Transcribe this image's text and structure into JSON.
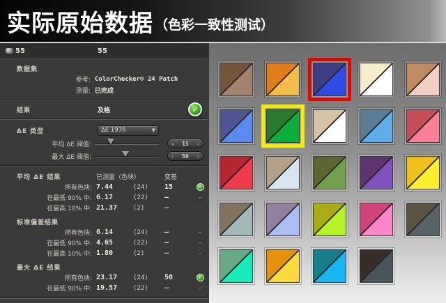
{
  "header": {
    "title": "实际原始数据",
    "subtitle": "（色彩一致性测试）"
  },
  "panel": {
    "top": {
      "left_label": "55",
      "center_label": "55"
    },
    "dataset": {
      "section_label": "数据集",
      "rows": [
        {
          "label": "参考:",
          "value": "ColorChecker® 24 Patch"
        },
        {
          "label": "测量:",
          "value": "已完成"
        }
      ]
    },
    "result": {
      "label": "结果",
      "value": "及格"
    },
    "de_type": {
      "label": "ΔE 类型",
      "dropdown_value": "ΔE 1976",
      "sliders": [
        {
          "label": "平均 ΔE 阈值:",
          "value": "15",
          "pos": 25
        },
        {
          "label": "最大 ΔE 阈值:",
          "value": "50",
          "pos": 48
        }
      ]
    },
    "results_table": {
      "col_measured": "已测量（色块）",
      "col_variance": "变差",
      "sections": [
        {
          "title": "平均 ΔE 结果",
          "rows": [
            {
              "label": "所有色块:",
              "value": "7.44",
              "count": "(24)",
              "variance": "15",
              "check": true
            },
            {
              "label": "在最低 90% 中:",
              "value": "6.17",
              "count": "(22)",
              "variance": "–",
              "check": false
            },
            {
              "label": "在最高 10% 中:",
              "value": "21.37",
              "count": "(2)",
              "variance": "–",
              "check": false
            }
          ]
        },
        {
          "title": "标准偏差结果",
          "rows": [
            {
              "label": "所有色块:",
              "value": "6.14",
              "count": "(24)",
              "variance": "–",
              "check": false
            },
            {
              "label": "在最低 90% 中:",
              "value": "4.65",
              "count": "(22)",
              "variance": "–",
              "check": false
            },
            {
              "label": "在最高 10% 中:",
              "value": "1.80",
              "count": "(2)",
              "variance": "–",
              "check": false
            }
          ]
        },
        {
          "title": "最大 ΔE 结果",
          "rows": [
            {
              "label": "所有色块:",
              "value": "23.17",
              "count": "(24)",
              "variance": "50",
              "check": true
            },
            {
              "label": "在最低 90% 中:",
              "value": "19.57",
              "count": "(22)",
              "variance": "–",
              "check": false
            }
          ]
        }
      ]
    }
  },
  "patch_grid": {
    "highlight_colors": {
      "red": "#e10600",
      "yellow": "#f5ea00"
    },
    "diagonal_line_color": "#23221e",
    "patches": [
      {
        "ul": "#74543c",
        "lr": "#a1836f"
      },
      {
        "ul": "#de7d1a",
        "lr": "#f3bc4a"
      },
      {
        "ul": "#3c3f84",
        "lr": "#2f4ce8",
        "highlight": "red"
      },
      {
        "ul": "#f7ecce",
        "lr": "#ffffff"
      },
      {
        "ul": "#c08a62",
        "lr": "#f2cfc2"
      },
      {
        "ul": "#4d5490",
        "lr": "#5b8af0"
      },
      {
        "ul": "#287b2d",
        "lr": "#0caf3c",
        "highlight": "yellow"
      },
      {
        "ul": "#d4c3a5",
        "lr": "#fbfdff"
      },
      {
        "ul": "#5c7d96",
        "lr": "#5facea"
      },
      {
        "ul": "#c34f58",
        "lr": "#fc8095"
      },
      {
        "ul": "#b52532",
        "lr": "#f03b4d"
      },
      {
        "ul": "#b3a288",
        "lr": "#d8e4ef"
      },
      {
        "ul": "#5d662e",
        "lr": "#71a04c"
      },
      {
        "ul": "#5c3472",
        "lr": "#8052c0"
      },
      {
        "ul": "#eec01b",
        "lr": "#fdee30"
      },
      {
        "ul": "#80735f",
        "lr": "#a3b8b8"
      },
      {
        "ul": "#95819f",
        "lr": "#aabdf5"
      },
      {
        "ul": "#abab16",
        "lr": "#b5f229"
      },
      {
        "ul": "#d04479",
        "lr": "#f787c8"
      },
      {
        "ul": "#5c5546",
        "lr": "#566468"
      },
      {
        "ul": "#66ab86",
        "lr": "#18ecbc"
      },
      {
        "ul": "#e5920f",
        "lr": "#fcd93d"
      },
      {
        "ul": "#177f8c",
        "lr": "#19b5f2"
      },
      {
        "ul": "#382e29",
        "lr": "#48555a"
      }
    ]
  }
}
